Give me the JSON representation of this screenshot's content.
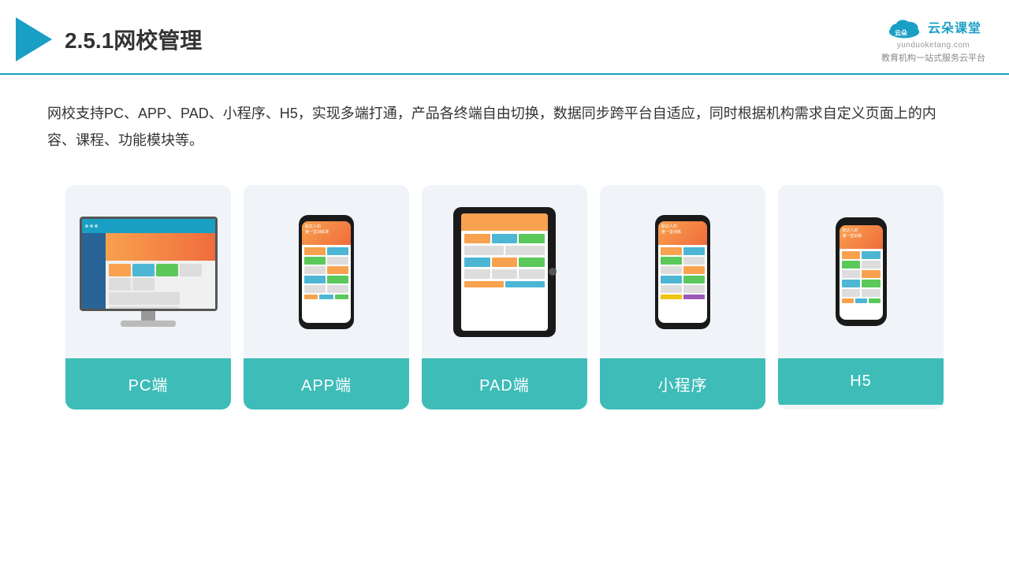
{
  "header": {
    "title": "2.5.1网校管理",
    "brand": {
      "name_cn": "云朵课堂",
      "name_en": "yunduoketang.com",
      "slogan": "教育机构一站\n式服务云平台"
    }
  },
  "description": "网校支持PC、APP、PAD、小程序、H5，实现多端打通，产品各终端自由切换，数据同步跨平台自适应，同时根据机构需求自定义页面上的内容、课程、功能模块等。",
  "cards": [
    {
      "id": "pc",
      "label": "PC端"
    },
    {
      "id": "app",
      "label": "APP端"
    },
    {
      "id": "pad",
      "label": "PAD端"
    },
    {
      "id": "miniapp",
      "label": "小程序"
    },
    {
      "id": "h5",
      "label": "H5"
    }
  ]
}
